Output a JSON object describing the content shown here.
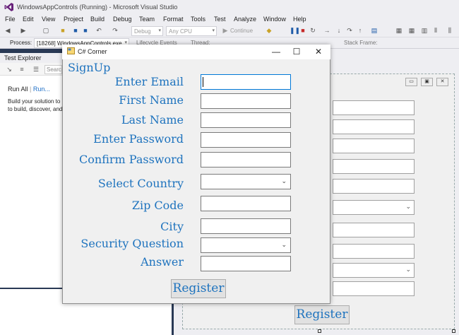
{
  "vs": {
    "title": "WindowsAppControls (Running) - Microsoft Visual Studio",
    "menu": [
      "File",
      "Edit",
      "View",
      "Project",
      "Build",
      "Debug",
      "Team",
      "Format",
      "Tools",
      "Test",
      "Analyze",
      "Window",
      "Help"
    ],
    "toolbar": {
      "config_combo": "Debug",
      "platform_combo": "Any CPU",
      "continue_label": "Continue"
    },
    "debugbar": {
      "process_label": "Process:",
      "process_value": "[18268] WindowsAppControls.exe",
      "lifecycle_label": "Lifecycle Events",
      "thread_label": "Thread:",
      "stackframe_label": "Stack Frame:"
    }
  },
  "test_explorer": {
    "title": "Test Explorer",
    "search_placeholder": "Search",
    "run_all": "Run All",
    "run_menu": "Run...",
    "message_line1": "Build your solution to",
    "message_line2": "to build, discover, and"
  },
  "designer": {
    "register_label": "Register"
  },
  "dialog": {
    "title": "C# Corner",
    "group_title": "SignUp",
    "labels": {
      "email": "Enter Email",
      "first_name": "First Name",
      "last_name": "Last Name",
      "password": "Enter Password",
      "confirm_password": "Confirm Password",
      "country": "Select Country",
      "zip": "Zip Code",
      "city": "City",
      "security_question": "Security Question",
      "answer": "Answer"
    },
    "register_label": "Register"
  }
}
